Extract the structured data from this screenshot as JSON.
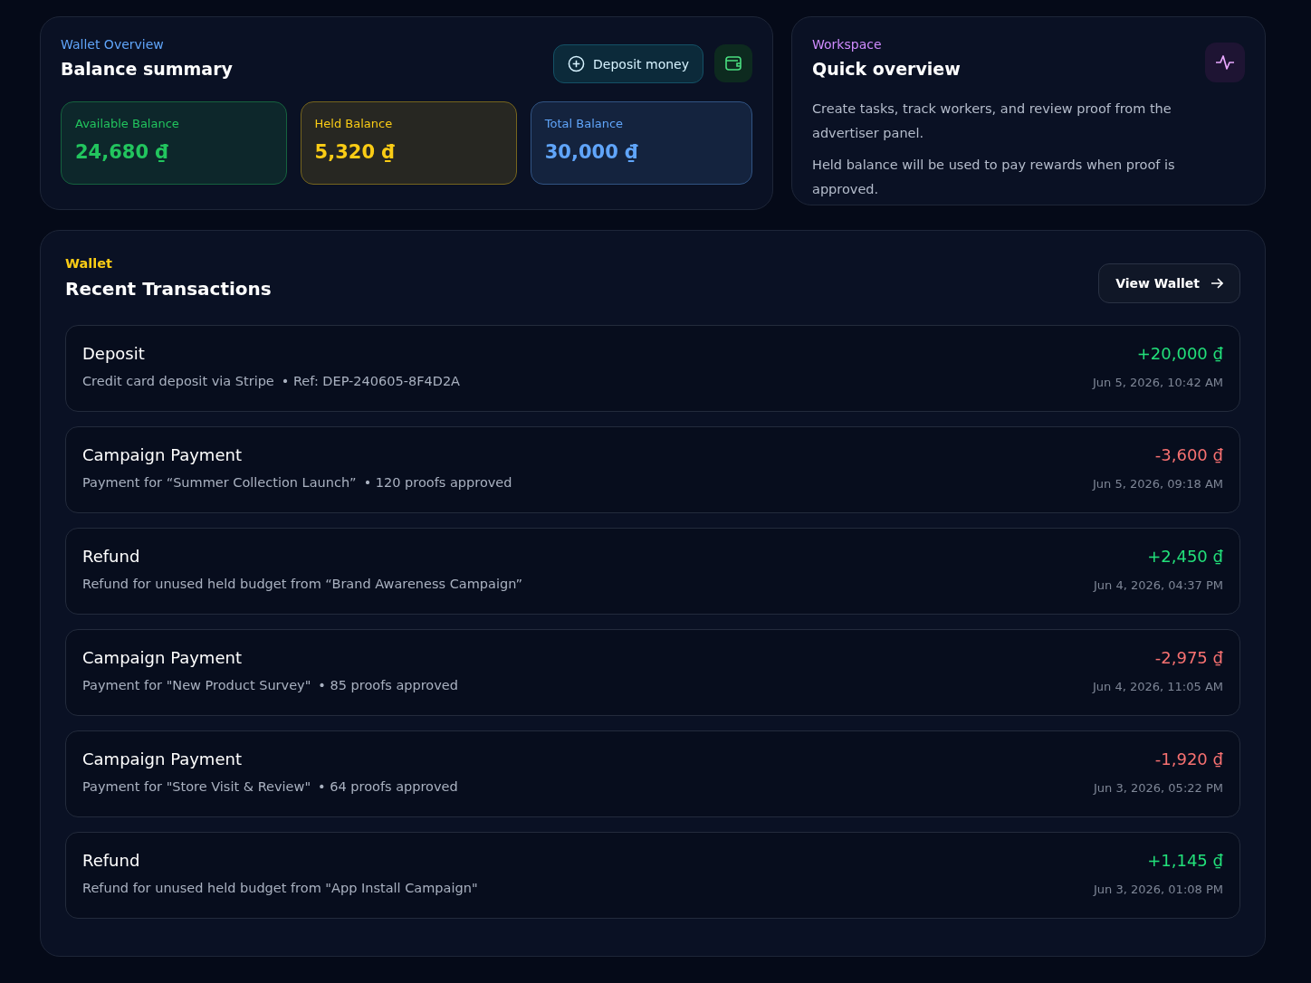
{
  "wallet_overview": {
    "eyebrow": "Wallet Overview",
    "title": "Balance summary",
    "deposit_button": "Deposit money",
    "balances": [
      {
        "label": "Available Balance",
        "amount": "24,680 ₫",
        "color": "#22c55e"
      },
      {
        "label": "Held Balance",
        "amount": "5,320 ₫",
        "color": "#facc15"
      },
      {
        "label": "Total Balance",
        "amount": "30,000 ₫",
        "color": "#60a5fa"
      }
    ]
  },
  "workspace": {
    "eyebrow": "Workspace",
    "title": "Quick overview",
    "paragraphs": [
      "Create tasks, track workers, and review proof from the advertiser panel.",
      "Held balance will be used to pay rewards when proof is approved."
    ]
  },
  "transactions": {
    "eyebrow": "Wallet",
    "title": "Recent Transactions",
    "view_button": "View Wallet",
    "items": [
      {
        "kind": "credit",
        "title": "Deposit",
        "description": "Credit card deposit via Stripe",
        "note": "• Ref: DEP-240605-8F4D2A",
        "amount": "+20,000 ₫",
        "time": "Jun 5, 2026, 10:42 AM"
      },
      {
        "kind": "debit",
        "title": "Campaign Payment",
        "description": "Payment for “Summer Collection Launch”",
        "note": "• 120 proofs approved",
        "amount": "-3,600 ₫",
        "time": "Jun 5, 2026, 09:18 AM"
      },
      {
        "kind": "credit",
        "title": "Refund",
        "description": "Refund for unused held budget from “Brand Awareness Campaign”",
        "amount": "+2,450 ₫",
        "time": "Jun 4, 2026, 04:37 PM"
      },
      {
        "kind": "debit",
        "title": "Campaign Payment",
        "description": "Payment for \"New Product Survey\"",
        "note": "• 85 proofs approved",
        "amount": "-2,975 ₫",
        "time": "Jun 4, 2026, 11:05 AM"
      },
      {
        "kind": "debit",
        "title": "Campaign Payment",
        "description": "Payment for \"Store Visit & Review\"",
        "note": "• 64 proofs approved",
        "amount": "-1,920 ₫",
        "time": "Jun 3, 2026, 05:22 PM"
      },
      {
        "kind": "credit",
        "title": "Refund",
        "description": "Refund for unused held budget from \"App Install Campaign\"",
        "amount": "+1,145 ₫",
        "time": "Jun 3, 2026, 01:08 PM"
      }
    ]
  }
}
